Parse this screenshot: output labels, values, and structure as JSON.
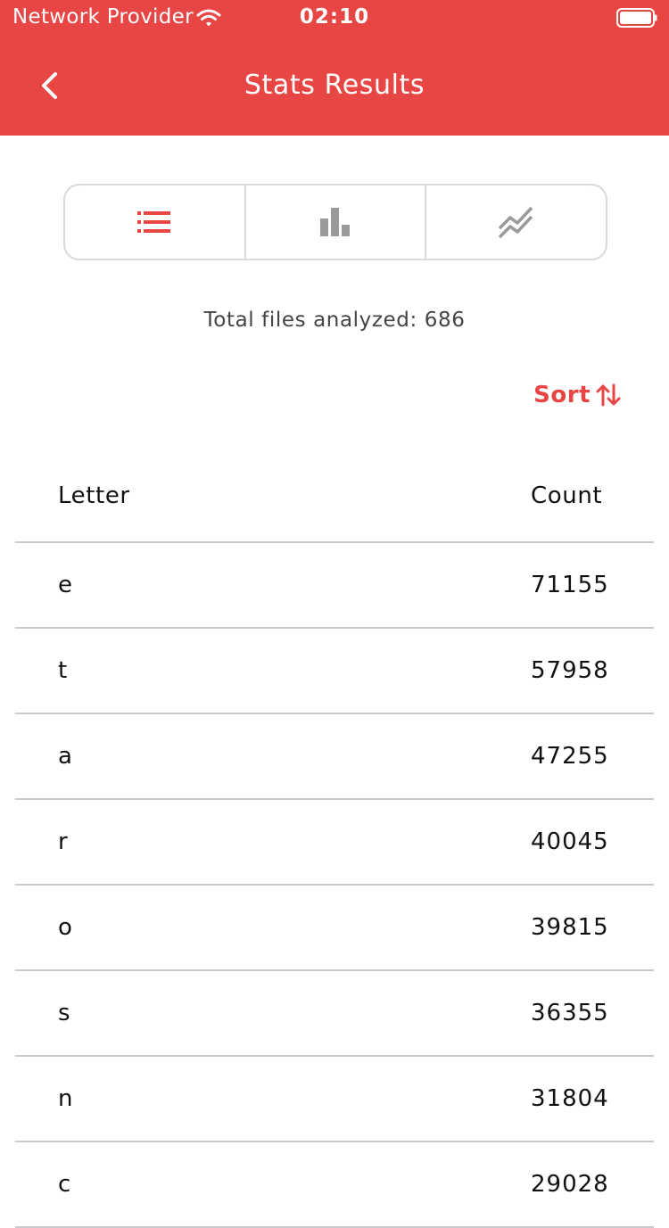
{
  "status_bar": {
    "carrier": "Network Provider",
    "time": "02:10"
  },
  "nav": {
    "title": "Stats Results"
  },
  "view_tabs": [
    {
      "icon": "list-icon",
      "active": true
    },
    {
      "icon": "bar-chart-icon",
      "active": false
    },
    {
      "icon": "line-chart-icon",
      "active": false
    }
  ],
  "summary": {
    "total_files": "Total files analyzed: 686"
  },
  "sort": {
    "label": "Sort"
  },
  "table": {
    "columns": [
      "Letter",
      "Count"
    ],
    "rows": [
      {
        "letter": "e",
        "count": "71155"
      },
      {
        "letter": "t",
        "count": "57958"
      },
      {
        "letter": "a",
        "count": "47255"
      },
      {
        "letter": "r",
        "count": "40045"
      },
      {
        "letter": "o",
        "count": "39815"
      },
      {
        "letter": "s",
        "count": "36355"
      },
      {
        "letter": "n",
        "count": "31804"
      },
      {
        "letter": "c",
        "count": "29028"
      }
    ]
  },
  "colors": {
    "accent": "#e84545",
    "inactive_icon": "#9a9a9a",
    "divider": "#c9c9ce",
    "segment_border": "#d9d9d9"
  }
}
